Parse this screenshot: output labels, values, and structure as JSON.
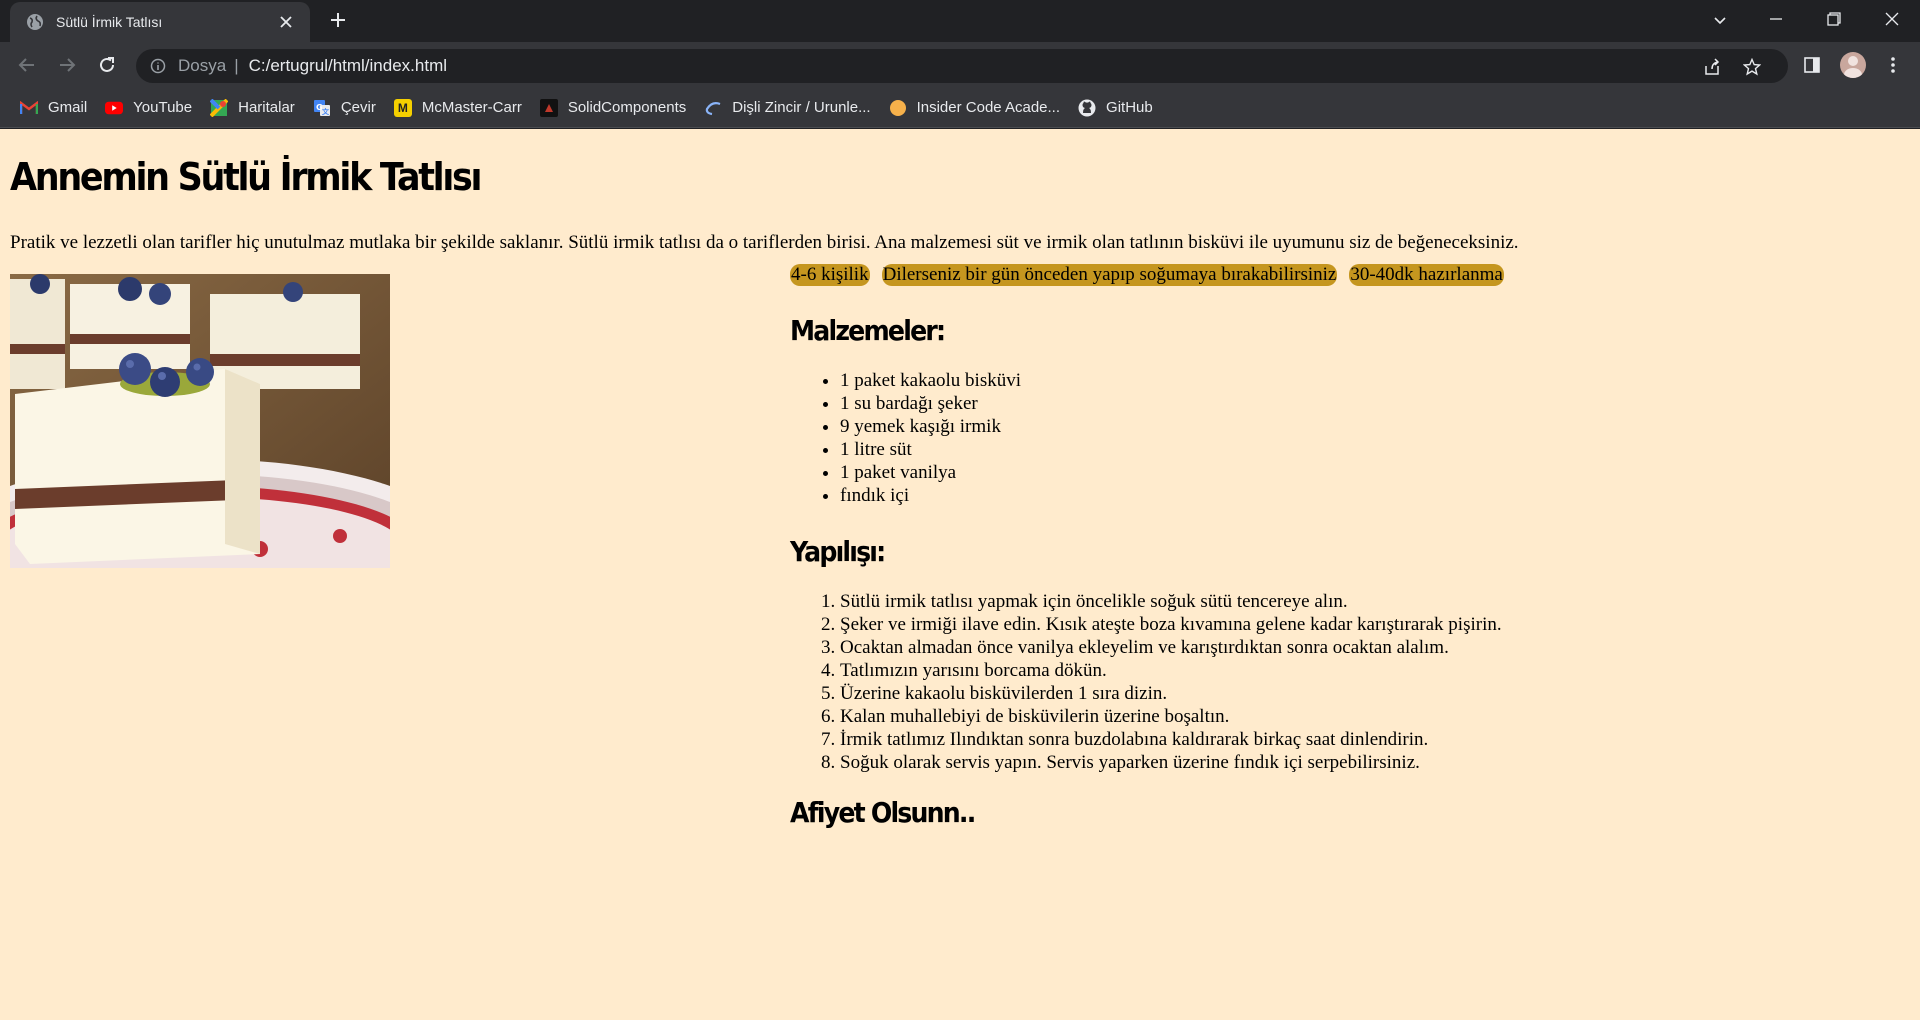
{
  "browser": {
    "tab": {
      "title": "Sütlü İrmik Tatlısı"
    },
    "address": {
      "scheme": "Dosya",
      "url": "C:/ertugrul/html/index.html"
    },
    "bookmarks": [
      {
        "label": "Gmail",
        "icon": "gmail-icon"
      },
      {
        "label": "YouTube",
        "icon": "youtube-icon"
      },
      {
        "label": "Haritalar",
        "icon": "maps-icon"
      },
      {
        "label": "Çevir",
        "icon": "translate-icon"
      },
      {
        "label": "McMaster-Carr",
        "icon": "mcmaster-icon"
      },
      {
        "label": "SolidComponents",
        "icon": "solidcomponents-icon"
      },
      {
        "label": "Dişli Zincir / Urunle...",
        "icon": "gear-chain-icon"
      },
      {
        "label": "Insider Code Acade...",
        "icon": "insider-icon"
      },
      {
        "label": "GitHub",
        "icon": "github-icon"
      }
    ]
  },
  "page": {
    "background": "#ffebcd",
    "title": "Annemin Sütlü İrmik Tatlısı",
    "intro": "Pratik ve lezzetli olan tarifler hiç unutulmaz mutlaka bir şekilde saklanır. Sütlü irmik tatlısı da o tariflerden birisi. Ana malzemesi süt ve irmik olan tatlının bisküvi ile uyumunu siz de beğeneceksiniz.",
    "tags": [
      "4-6 kişilik",
      "Dilerseniz bir gün önceden yapıp soğumaya bırakabilirsiniz",
      "30-40dk hazırlanma"
    ],
    "tag_color": "#c5961f",
    "ingredients_heading": "Malzemeler:",
    "ingredients": [
      "1 paket kakaolu bisküvi",
      "1 su bardağı şeker",
      "9 yemek kaşığı irmik",
      "1 litre süt",
      "1 paket vanilya",
      "fındık içi"
    ],
    "steps_heading": "Yapılışı:",
    "steps": [
      "Sütlü irmik tatlısı yapmak için öncelikle soğuk sütü tencereye alın.",
      "Şeker ve irmiği ilave edin. Kısık ateşte boza kıvamına gelene kadar karıştırarak pişirin.",
      "Ocaktan almadan önce vanilya ekleyelim ve karıştırdıktan sonra ocaktan alalım.",
      "Tatlımızın yarısını borcama dökün.",
      "Üzerine kakaolu bisküvilerden 1 sıra dizin.",
      "Kalan muhallebiyi de bisküvilerin üzerine boşaltın.",
      "İrmik tatlımız Ilındıktan sonra buzdolabına kaldırarak birkaç saat dinlendirin.",
      "Soğuk olarak servis yapın. Servis yaparken üzerine fındık içi serpebilirsiniz."
    ],
    "closing": "Afiyet Olsunn.."
  }
}
